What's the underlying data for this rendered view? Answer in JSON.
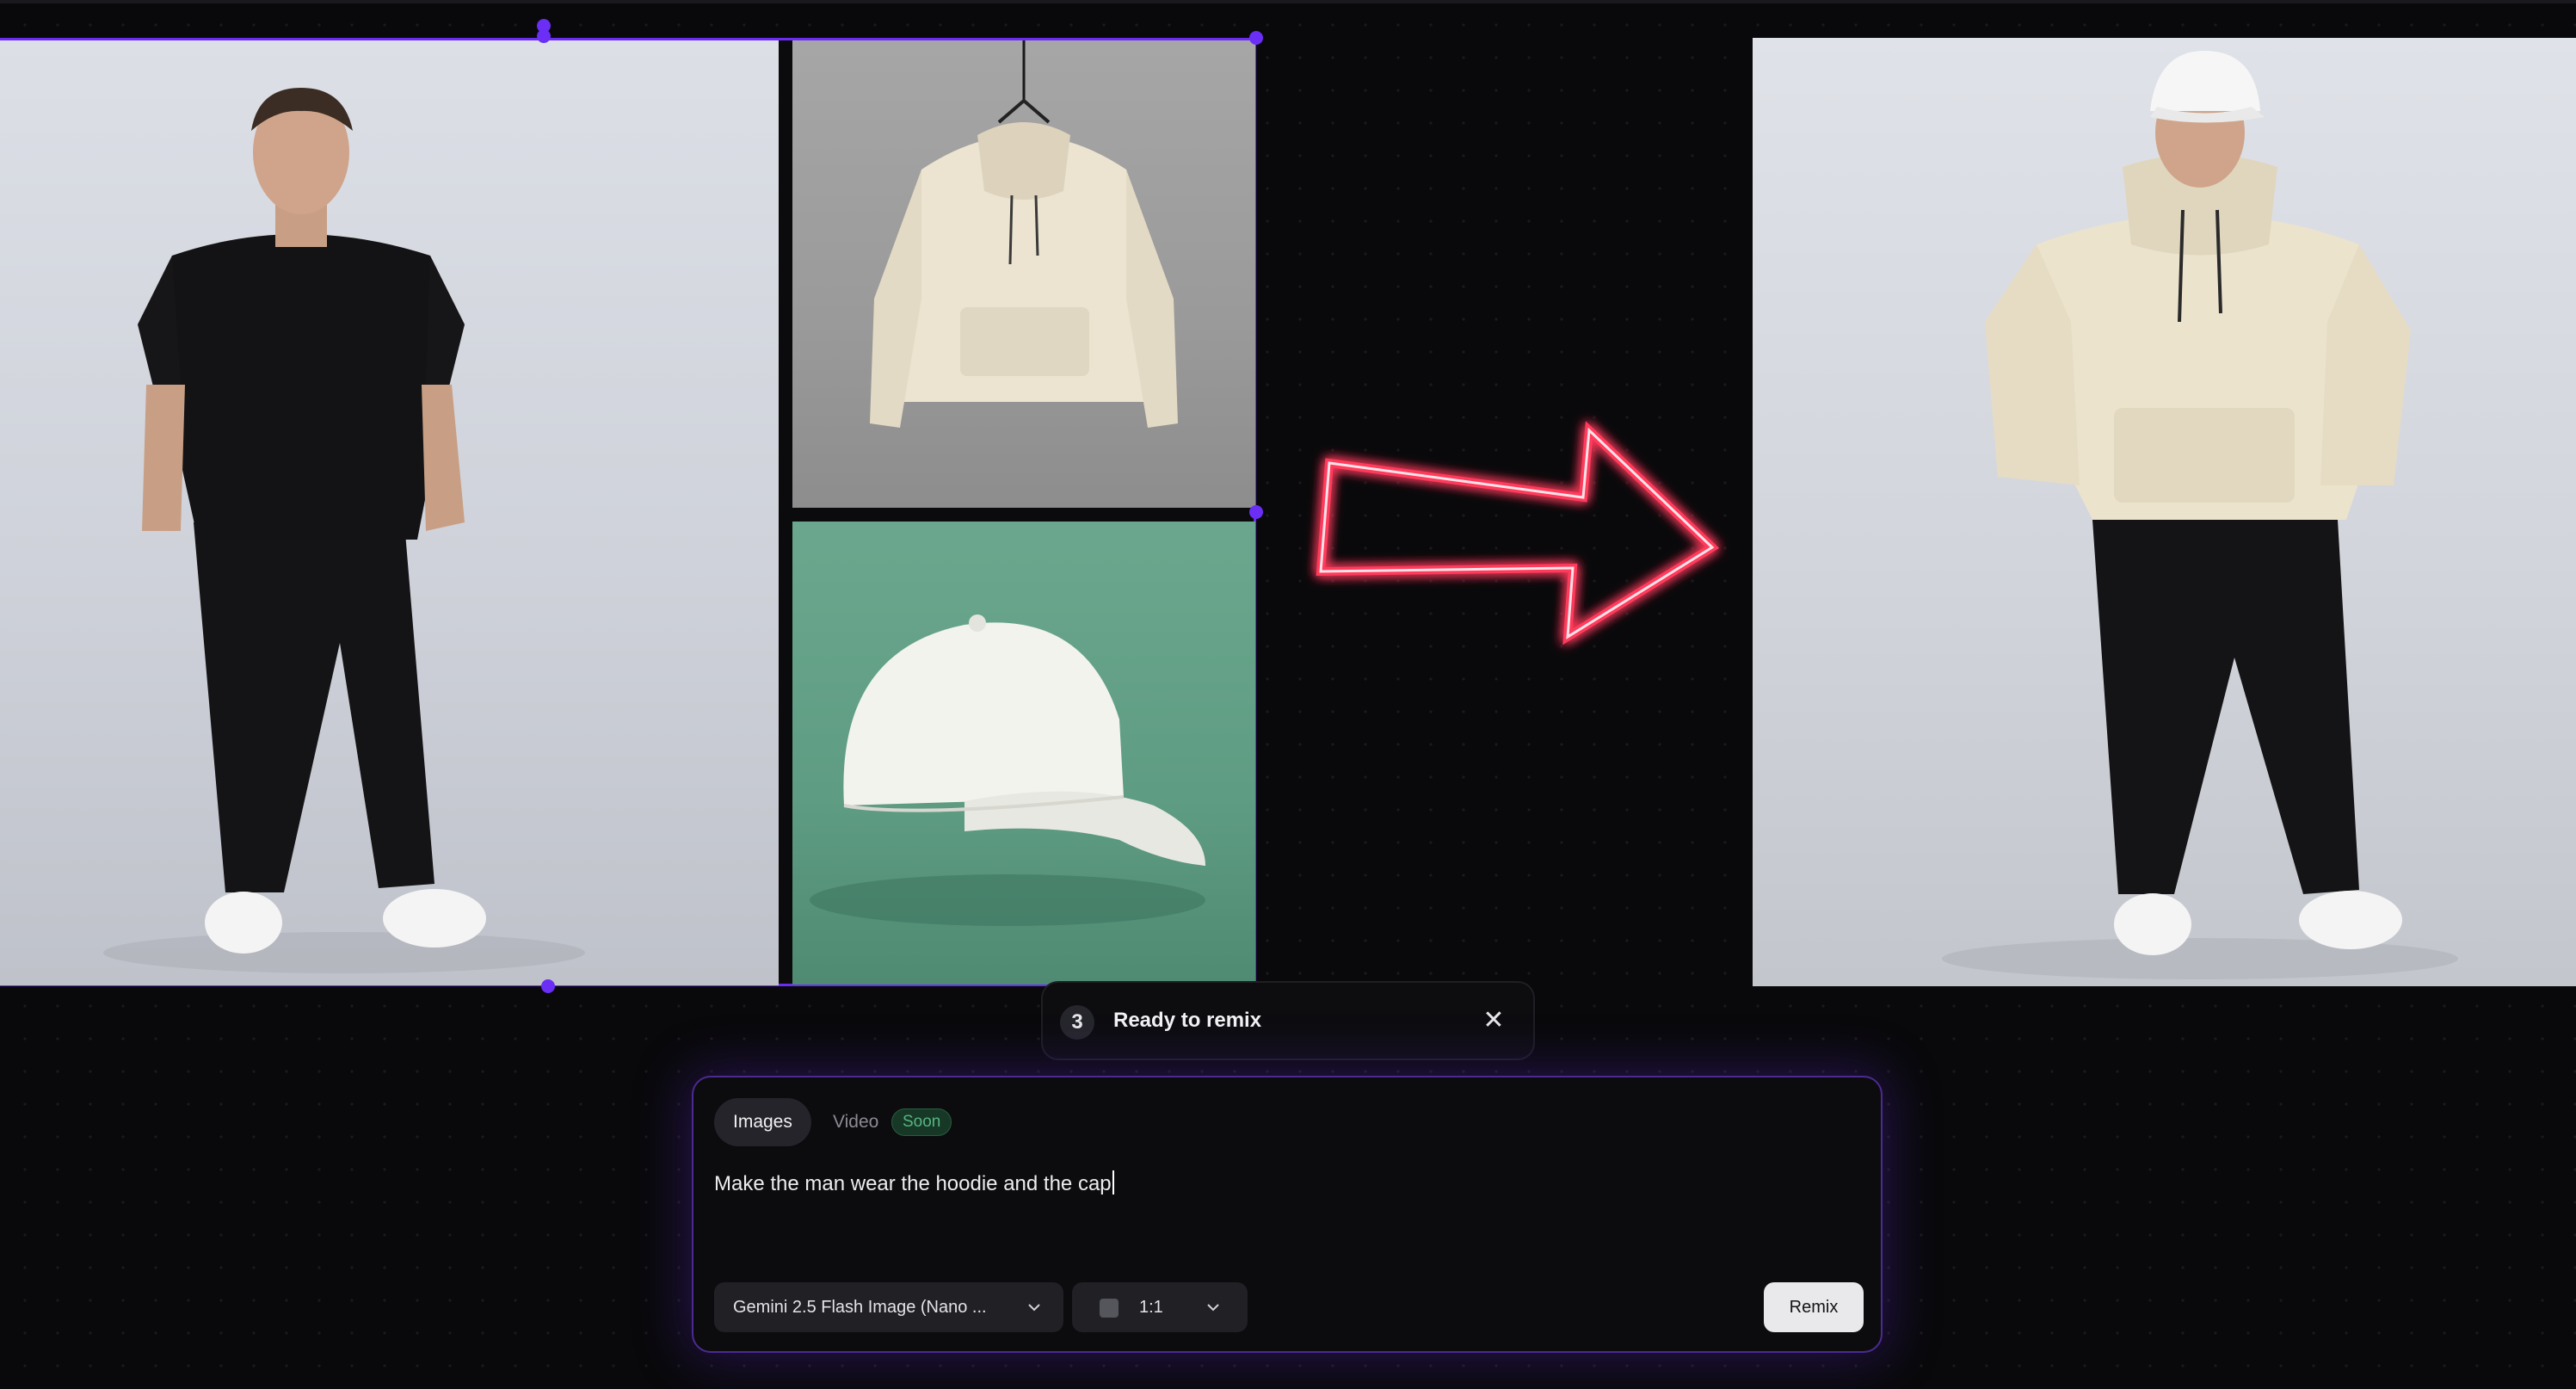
{
  "canvas": {
    "status": {
      "count": "3",
      "text": "Ready to remix"
    },
    "prompt": {
      "tabs": [
        {
          "label": "Images",
          "active": true
        },
        {
          "label": "Video",
          "active": false,
          "badge": "Soon"
        }
      ],
      "text": "Make the man wear the hoodie and the cap",
      "model": "Gemini 2.5 Flash Image (Nano ...",
      "ratio": "1:1",
      "submit_label": "Remix"
    },
    "icons": {
      "close": "close-icon",
      "chevron": "chevron-down-icon",
      "arrow": "neon-arrow-right"
    },
    "colors": {
      "selection": "#6d2cf5",
      "neon": "#ff3b5c",
      "badge_green": "#56b582"
    }
  }
}
